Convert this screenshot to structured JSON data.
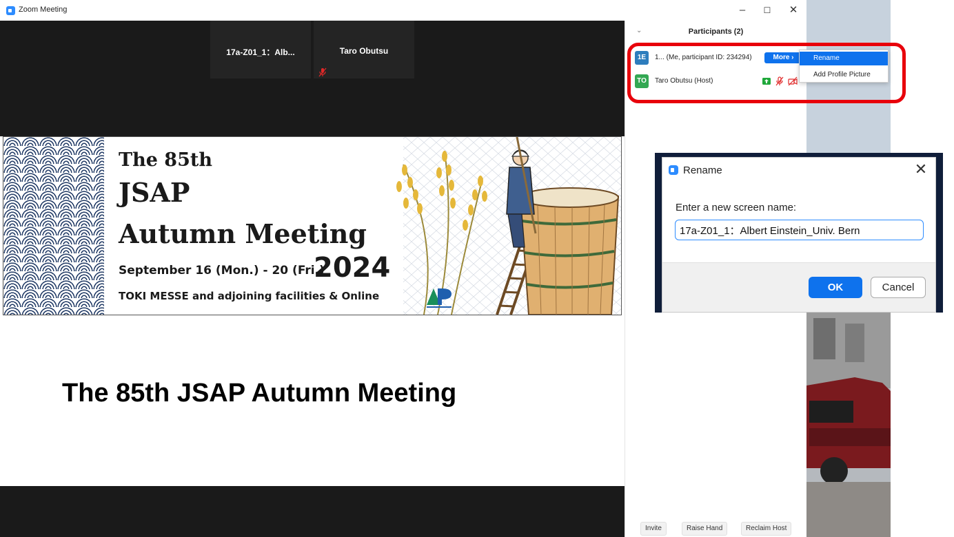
{
  "window": {
    "title": "Zoom Meeting",
    "minimize_glyph": "–",
    "maximize_glyph": "☐",
    "close_glyph": "✕"
  },
  "tiles": [
    {
      "name": "17a-Z01_1：Alb...",
      "muted": false
    },
    {
      "name": "Taro Obutsu",
      "muted": true
    }
  ],
  "slide": {
    "banner_line1": "The 85th",
    "banner_line2": "JSAP",
    "banner_line3": "Autumn Meeting",
    "banner_dates": "September 16 (Mon.) - 20 (Fri.)",
    "banner_year": "2024",
    "banner_venue": "TOKI MESSE and adjoining facilities & Online",
    "title": "The 85th JSAP Autumn Meeting"
  },
  "participants": {
    "header": "Participants (2)",
    "collapse_glyph": "⌄",
    "list": [
      {
        "initials": "1E",
        "name": "1... (Me, participant ID: 234294)",
        "avatar_color": "#2d7dbd"
      },
      {
        "initials": "TO",
        "name": "Taro Obutsu (Host)",
        "avatar_color": "#33a853"
      }
    ],
    "more_label": "More ›",
    "menu": {
      "rename": "Rename",
      "add_picture": "Add Profile Picture"
    },
    "footer": {
      "invite": "Invite",
      "raise_hand": "Raise Hand",
      "reclaim_host": "Reclaim Host"
    }
  },
  "rename_dialog": {
    "title": "Rename",
    "close_glyph": "✕",
    "prompt": "Enter a new screen name:",
    "value": "17a-Z01_1：Albert Einstein_Univ. Bern",
    "ok": "OK",
    "cancel": "Cancel"
  },
  "colors": {
    "accent": "#0e72ed",
    "highlight": "#e8000b",
    "muted_icon": "#e02828",
    "share_icon": "#1fa83a"
  },
  "icons": [
    "zoom-logo-icon",
    "mic-muted-icon",
    "video-off-icon",
    "share-screen-icon",
    "chevron-down-icon",
    "close-icon"
  ]
}
